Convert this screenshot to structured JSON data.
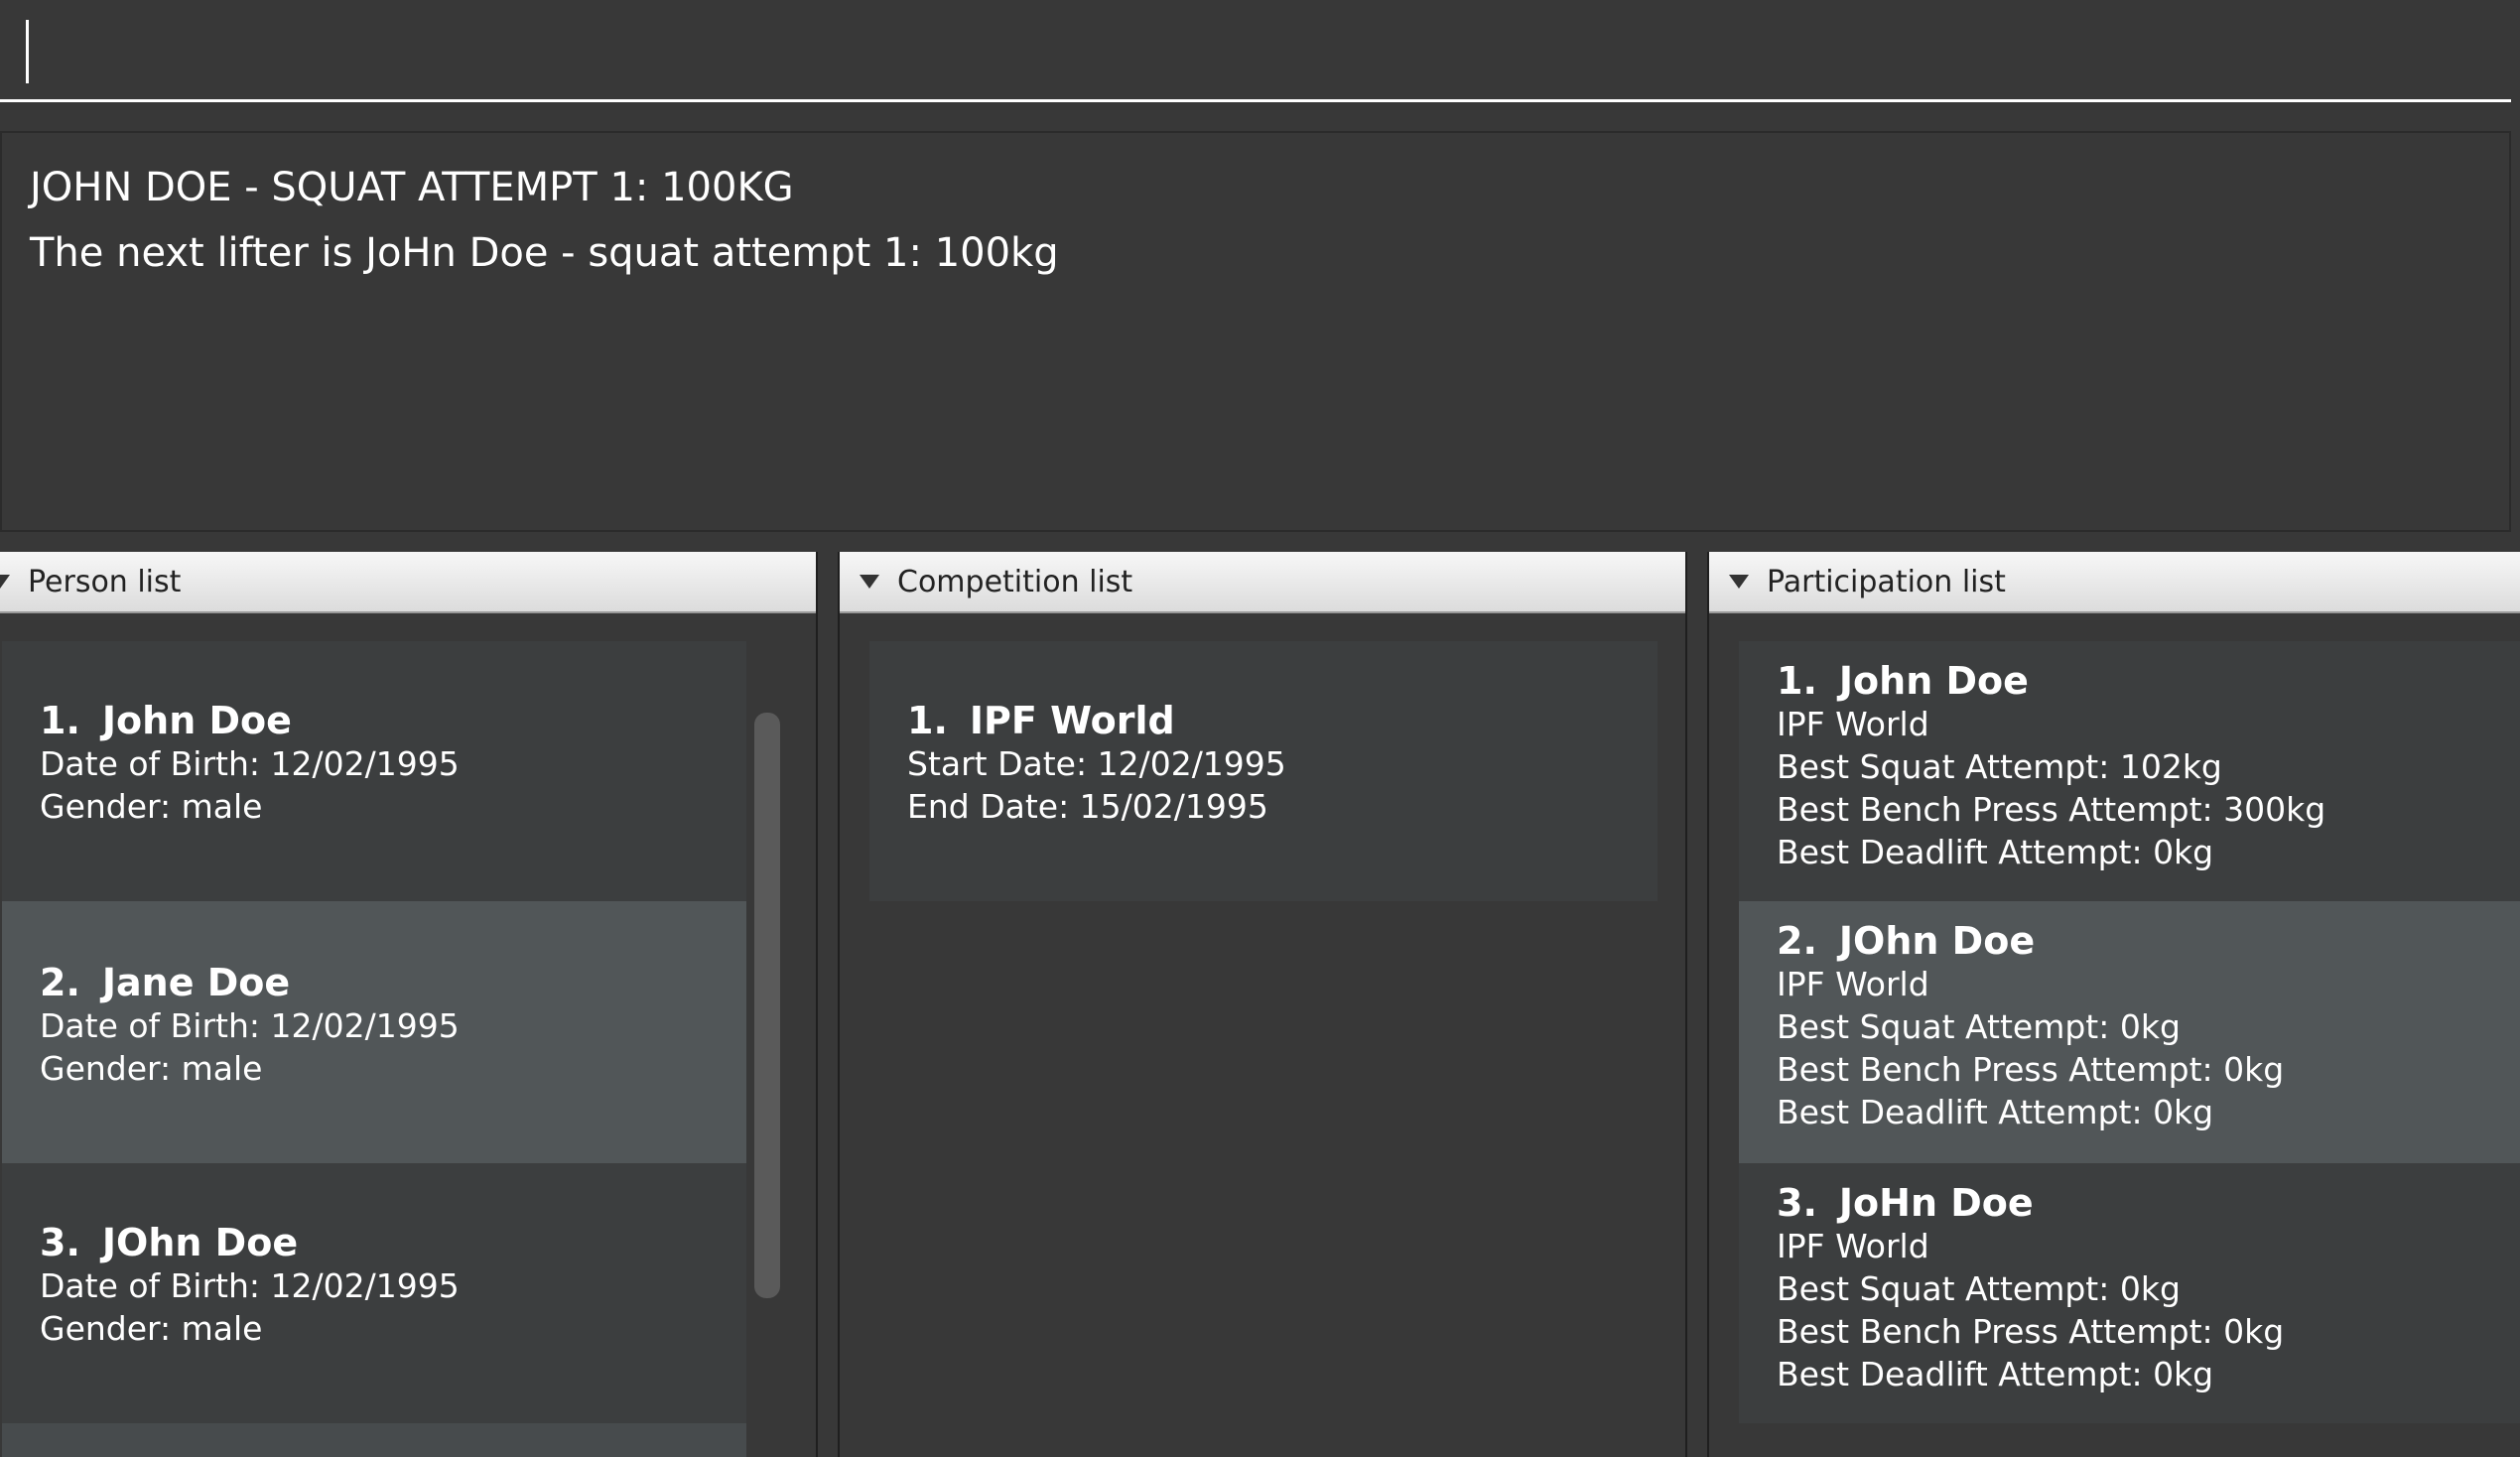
{
  "command": {
    "value": ""
  },
  "result": {
    "line1": "JOHN DOE - SQUAT ATTEMPT 1: 100KG",
    "line2": "The next lifter is JoHn Doe - squat attempt 1: 100kg"
  },
  "person_panel": {
    "title": "Person list",
    "items": [
      {
        "index": "1.",
        "name": "John Doe",
        "dob": "Date of Birth: 12/02/1995",
        "gender": "Gender: male"
      },
      {
        "index": "2.",
        "name": "Jane Doe",
        "dob": "Date of Birth: 12/02/1995",
        "gender": "Gender: male"
      },
      {
        "index": "3.",
        "name": "JOhn Doe",
        "dob": "Date of Birth: 12/02/1995",
        "gender": "Gender: male"
      }
    ]
  },
  "competition_panel": {
    "title": "Competition list",
    "items": [
      {
        "index": "1.",
        "name": "IPF World",
        "start": "Start Date: 12/02/1995",
        "end": "End Date: 15/02/1995"
      }
    ]
  },
  "participation_panel": {
    "title": "Participation list",
    "items": [
      {
        "index": "1.",
        "name": "John Doe",
        "competition": "IPF World",
        "squat": "Best Squat Attempt: 102kg",
        "bench": "Best Bench Press Attempt: 300kg",
        "deadlift": "Best Deadlift Attempt: 0kg"
      },
      {
        "index": "2.",
        "name": "JOhn Doe",
        "competition": "IPF World",
        "squat": "Best Squat Attempt: 0kg",
        "bench": "Best Bench Press Attempt: 0kg",
        "deadlift": "Best Deadlift Attempt: 0kg"
      },
      {
        "index": "3.",
        "name": "JoHn Doe",
        "competition": "IPF World",
        "squat": "Best Squat Attempt: 0kg",
        "bench": "Best Bench Press Attempt: 0kg",
        "deadlift": "Best Deadlift Attempt: 0kg"
      }
    ]
  },
  "colors": {
    "background": "#383838",
    "card": "#3c3e3f",
    "card_selected": "#515658",
    "header": "#e8e8e8"
  }
}
